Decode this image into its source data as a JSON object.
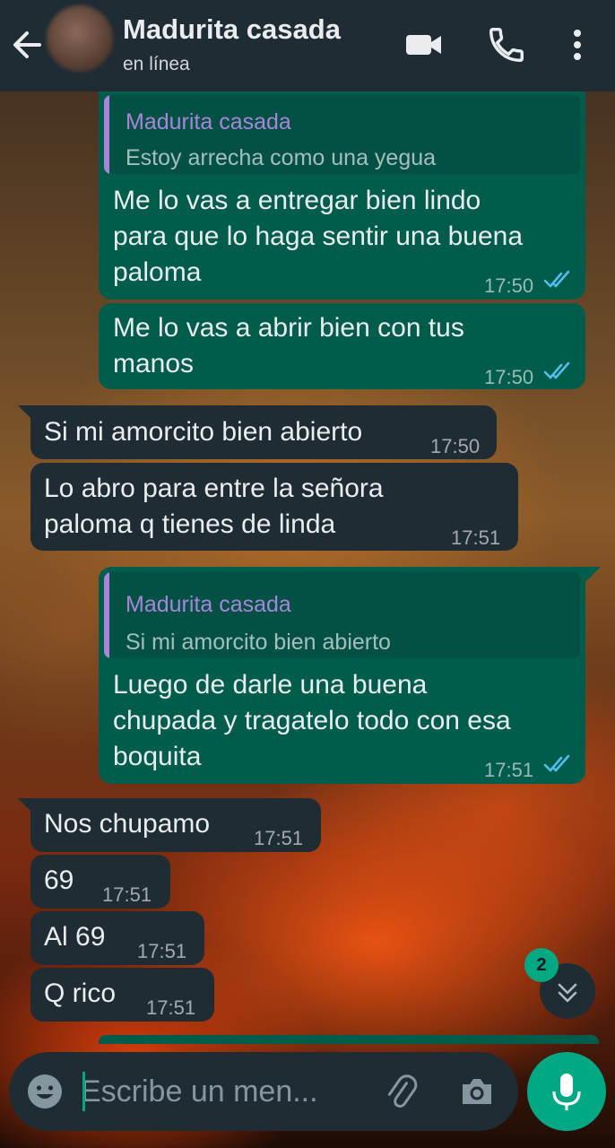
{
  "header": {
    "contact_name": "Madurita casada",
    "status": "en línea"
  },
  "messages": [
    {
      "direction": "outgoing",
      "quote": {
        "author": "Madurita casada",
        "text": "Estoy arrecha como una yegua"
      },
      "lines": [
        "Me lo vas a entregar bien lindo",
        "para que lo haga sentir una buena",
        "paloma"
      ],
      "time": "17:50",
      "read": true
    },
    {
      "direction": "outgoing",
      "lines": [
        "Me lo vas a abrir bien con tus",
        "manos"
      ],
      "time": "17:50",
      "read": true
    },
    {
      "direction": "incoming",
      "lines": [
        "Si mi amorcito bien abierto"
      ],
      "time": "17:50"
    },
    {
      "direction": "incoming",
      "lines": [
        "Lo abro para entre la señora",
        "paloma q tienes de linda"
      ],
      "time": "17:51"
    },
    {
      "direction": "outgoing",
      "quote": {
        "author": "Madurita casada",
        "text": "Si mi amorcito bien abierto"
      },
      "lines": [
        "Luego de darle una buena",
        "chupada y tragatelo todo con esa",
        "boquita"
      ],
      "time": "17:51",
      "read": true
    },
    {
      "direction": "incoming",
      "lines": [
        "Nos chupamo"
      ],
      "time": "17:51"
    },
    {
      "direction": "incoming",
      "lines": [
        "69"
      ],
      "time": "17:51"
    },
    {
      "direction": "incoming",
      "lines": [
        "Al 69"
      ],
      "time": "17:51"
    },
    {
      "direction": "incoming",
      "lines": [
        "Q rico"
      ],
      "time": "17:51"
    }
  ],
  "unread_count": "2",
  "composer": {
    "placeholder": "Escribe un men..."
  },
  "icons": {
    "back": "arrow-left-icon",
    "video": "video-camera-icon",
    "call": "phone-icon",
    "menu": "more-vert-icon",
    "emoji": "smiley-icon",
    "attach": "paperclip-icon",
    "camera": "camera-icon",
    "mic": "microphone-icon",
    "scroll": "double-chevron-down-icon",
    "read_receipt": "double-check-icon"
  },
  "colors": {
    "header_bg": "#1f2c33",
    "outgoing_bubble": "#005c4b",
    "incoming_bubble": "#1f2c34",
    "quote_author": "#a785db",
    "accent": "#00a884",
    "read_tick": "#53bdeb"
  }
}
